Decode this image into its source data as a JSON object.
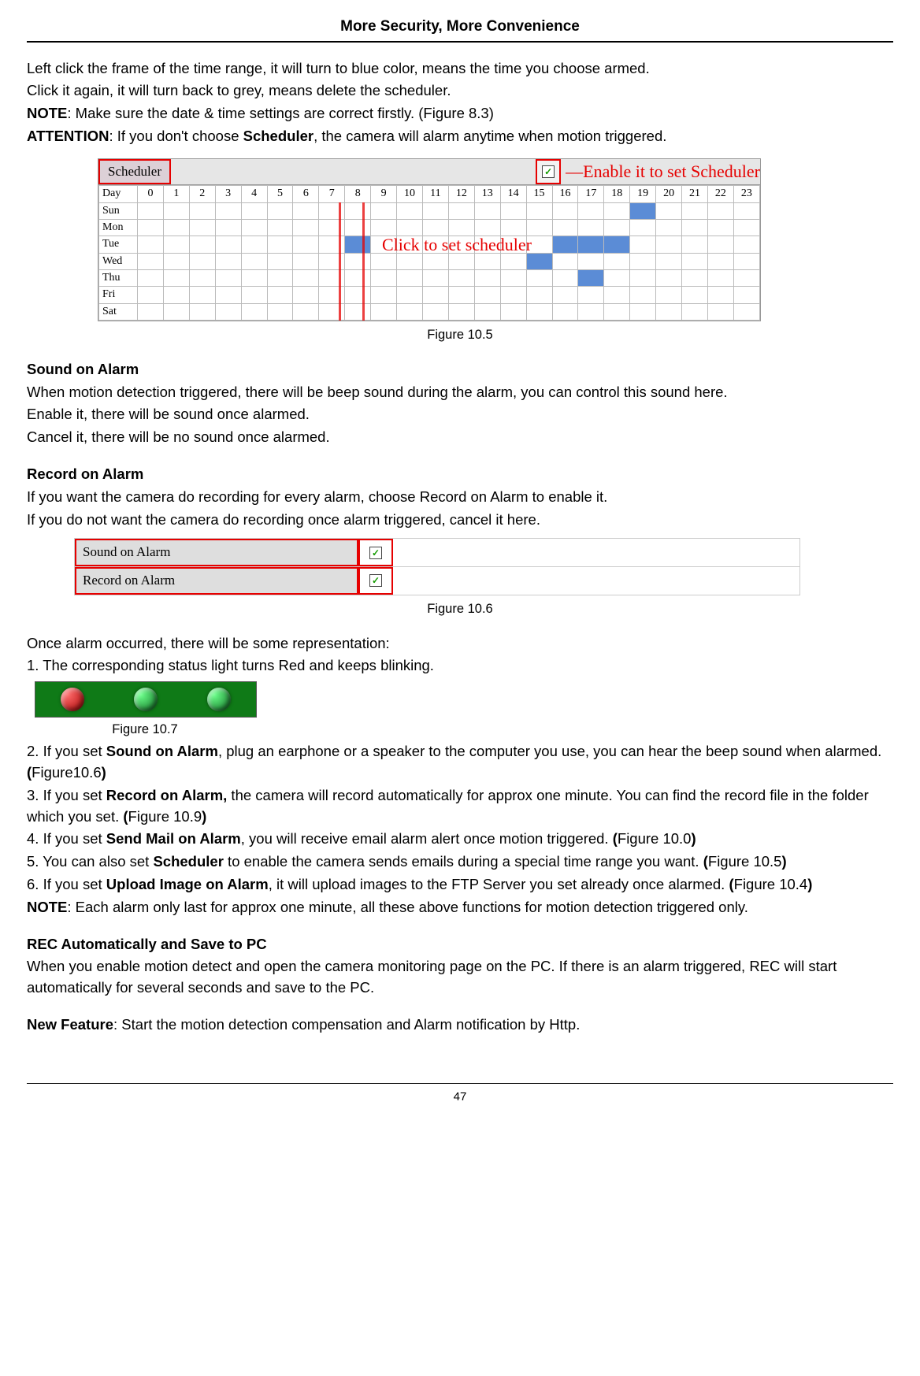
{
  "header": "More Security, More Convenience",
  "intro": {
    "l1": "Left click the frame of the time range, it will turn to blue color, means the time you choose armed.",
    "l2": "Click it again, it will turn back to grey, means delete the scheduler.",
    "note_label": "NOTE",
    "note_text": ": Make sure the date & time settings are correct firstly. (Figure 8.3)",
    "att_label": "ATTENTION",
    "att_text1": ": If you don't choose ",
    "att_bold": "Scheduler",
    "att_text2": ", the camera will alarm anytime when motion triggered."
  },
  "fig105": {
    "label": "Scheduler",
    "enable_text": "Enable it to set Scheduler",
    "click_text": "Click to set scheduler",
    "hours": [
      "0",
      "1",
      "2",
      "3",
      "4",
      "5",
      "6",
      "7",
      "8",
      "9",
      "10",
      "11",
      "12",
      "13",
      "14",
      "15",
      "16",
      "17",
      "18",
      "19",
      "20",
      "21",
      "22",
      "23"
    ],
    "days": [
      "Sun",
      "Mon",
      "Tue",
      "Wed",
      "Thu",
      "Fri",
      "Sat"
    ],
    "caption": "Figure 10.5"
  },
  "sound": {
    "title": "Sound on Alarm",
    "l1": "When motion detection triggered, there will be beep sound during the alarm, you can control this sound here.",
    "l2": "Enable it, there will be sound once alarmed.",
    "l3": "Cancel it, there will be no sound once alarmed."
  },
  "record": {
    "title": "Record on Alarm",
    "l1": "If you want the camera do recording for every alarm, choose Record on Alarm to enable it.",
    "l2": "If you do not want the camera do recording once alarm triggered, cancel it here."
  },
  "fig106": {
    "row1": "Sound on Alarm",
    "row2": "Record on Alarm",
    "caption": "Figure 10.6"
  },
  "rep": {
    "intro": "Once alarm occurred, there will be some representation:",
    "i1": "1. The corresponding status light turns Red and keeps blinking.",
    "fig107_caption": "Figure 10.7",
    "i2a": "2. If you set ",
    "i2b": "Sound on Alarm",
    "i2c": ", plug an earphone or a speaker to the computer you use, you can hear the beep sound when alarmed. ",
    "i2d": "(",
    "i2e": "Figure10.6",
    "i2f": ")",
    "i3a": "3. If you set ",
    "i3b": "Record on Alarm,",
    "i3c": " the camera will record automatically for approx one minute. You can find the record file in the folder which you set. ",
    "i3d": "(",
    "i3e": "Figure 10.9",
    "i3f": ")",
    "i4a": "4. If you set ",
    "i4b": "Send Mail on Alarm",
    "i4c": ", you will receive email alarm alert once motion triggered. ",
    "i4d": "(",
    "i4e": "Figure 10.0",
    "i4f": ")",
    "i5a": "5. You can also set ",
    "i5b": "Scheduler",
    "i5c": " to enable the camera sends emails during a special time range you want. ",
    "i5d": "(",
    "i5e": "Figure 10.5",
    "i5f": ")",
    "i6a": "6. If you set ",
    "i6b": "Upload Image on Alarm",
    "i6c": ", it will upload images to the FTP Server you set already once alarmed. ",
    "i6d": "(",
    "i6e": "Figure 10.4",
    "i6f": ")",
    "note_label": "NOTE",
    "note_text": ": Each alarm only last for approx one minute, all these above functions for motion detection triggered only."
  },
  "rec": {
    "title": "REC Automatically and Save to PC",
    "body": "When you enable motion detect and open the camera monitoring page on the PC. If there is an alarm triggered, REC will start automatically for several seconds and save to the PC."
  },
  "newfeat": {
    "label": "New Feature",
    "text": ": Start the motion detection compensation and Alarm notification by Http."
  },
  "page_number": "47"
}
